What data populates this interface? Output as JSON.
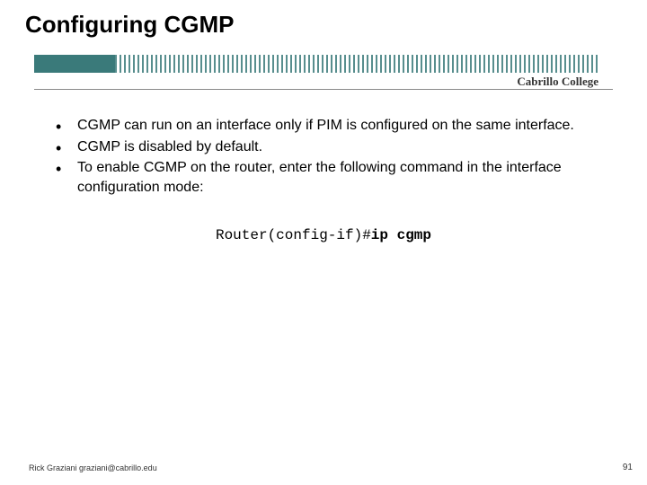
{
  "title": "Configuring CGMP",
  "college": "Cabrillo College",
  "bullets": [
    "CGMP can run on an interface only if PIM is configured on the same interface.",
    "CGMP is disabled by default.",
    "To enable CGMP on the router, enter the following command in the interface configuration mode:"
  ],
  "command": {
    "prompt": "Router(config-if)#",
    "cmd": "ip cgmp"
  },
  "footer": "Rick Graziani  graziani@cabrillo.edu",
  "page_number": "91"
}
